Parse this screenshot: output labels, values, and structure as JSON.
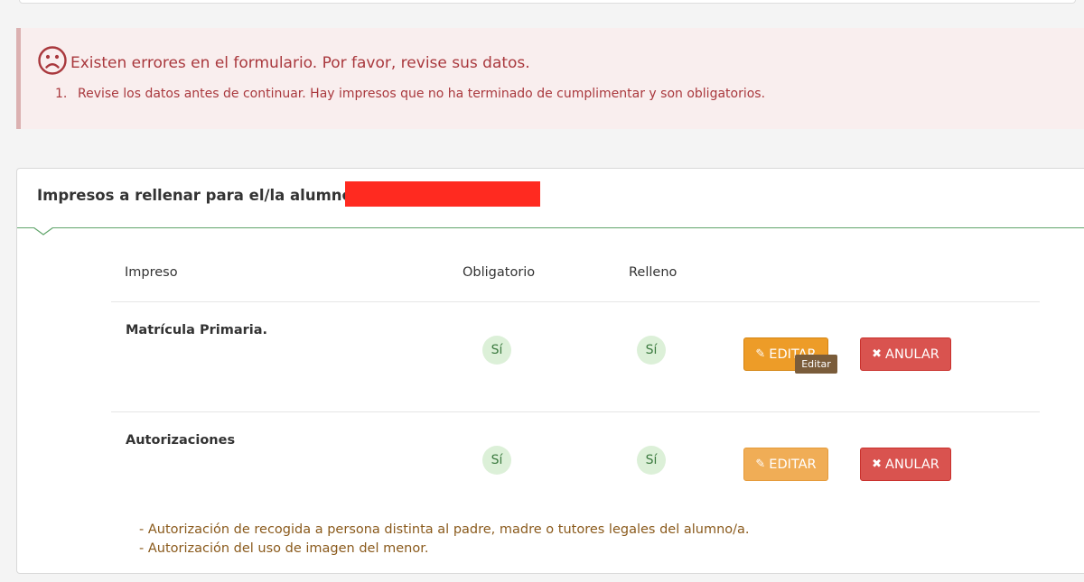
{
  "alert": {
    "title": "Existen errores en el formulario. Por favor, revise sus datos.",
    "items": [
      {
        "number": "1.",
        "text": "Revise los datos antes de continuar. Hay impresos que no ha terminado de cumplimentar y son obligatorios."
      }
    ]
  },
  "panel": {
    "title": "Impresos a rellenar para el/la alumno/a:"
  },
  "table": {
    "headers": [
      "Impreso",
      "Obligatorio",
      "Relleno"
    ],
    "rows": [
      {
        "name": "Matrícula Primaria.",
        "obligatorio": "Sí",
        "relleno": "Sí",
        "edit_label": "EDITAR",
        "cancel_label": "ANULAR"
      },
      {
        "name": "Autorizaciones",
        "obligatorio": "Sí",
        "relleno": "Sí",
        "edit_label": "EDITAR",
        "cancel_label": "ANULAR"
      }
    ]
  },
  "tooltip": "Editar",
  "notes": [
    "- Autorización de recogida a persona distinta al padre, madre o tutores legales del alumno/a.",
    "- Autorización del uso de imagen del menor."
  ],
  "icons": {
    "alert": "sad-face-icon",
    "edit": "pencil-icon",
    "cancel": "x-icon"
  },
  "colors": {
    "error_text": "#a9383d",
    "edit_button": "#ed9c28",
    "cancel_button": "#d9534f",
    "badge_bg": "#dcf0d8",
    "header_line": "#5fa46a"
  }
}
